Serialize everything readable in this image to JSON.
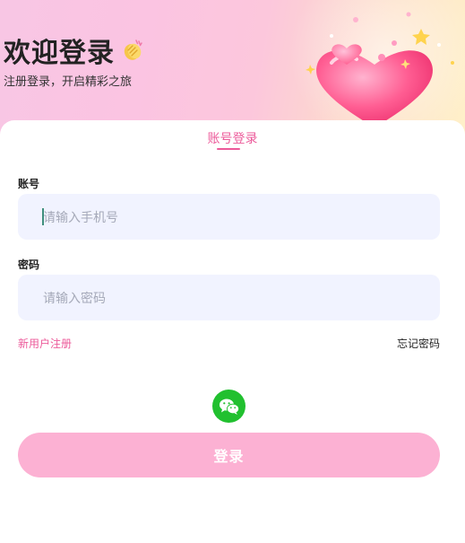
{
  "header": {
    "title": "欢迎登录",
    "subtitle": "注册登录，开启精彩之旅"
  },
  "tabs": [
    {
      "label": "账号登录",
      "active": true
    }
  ],
  "form": {
    "account_label": "账号",
    "account_placeholder": "请输入手机号",
    "account_value": "",
    "password_label": "密码",
    "password_placeholder": "请输入密码",
    "password_value": ""
  },
  "links": {
    "register": "新用户注册",
    "forgot": "忘记密码"
  },
  "social": {
    "icon": "wechat-icon"
  },
  "login_button": "登录",
  "colors": {
    "accent": "#ec5a9a",
    "button": "#fcb1d3",
    "input_bg": "#f1f3ff",
    "wechat": "#21c02f"
  }
}
